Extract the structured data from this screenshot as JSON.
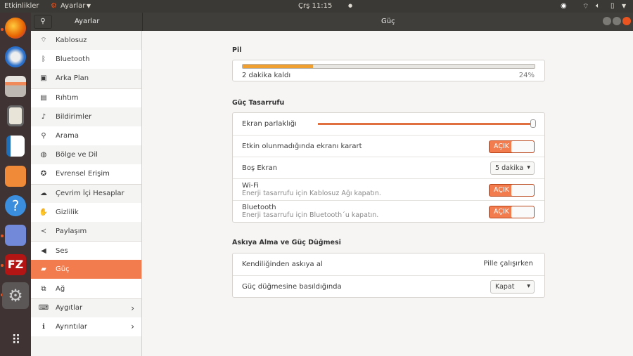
{
  "topbar": {
    "activities": "Etkinlikler",
    "app": "Ayarlar",
    "clock": "Çrş 11:15"
  },
  "dock": {
    "apps": [
      "firefox",
      "thunderbird",
      "files",
      "rhythmbox",
      "writer",
      "software-center",
      "help",
      "discord",
      "filezilla",
      "settings",
      "show-apps"
    ]
  },
  "header": {
    "sidebar_title": "Ayarlar",
    "page_title": "Güç"
  },
  "sidebar": {
    "items": [
      {
        "label": "Kablosuz",
        "icon": "wifi-icon"
      },
      {
        "label": "Bluetooth",
        "icon": "bluetooth-icon"
      },
      {
        "label": "Arka Plan",
        "icon": "background-icon"
      },
      {
        "label": "Rıhtım",
        "icon": "dock-icon"
      },
      {
        "label": "Bildirimler",
        "icon": "bell-icon"
      },
      {
        "label": "Arama",
        "icon": "search-icon"
      },
      {
        "label": "Bölge ve Dil",
        "icon": "globe-icon"
      },
      {
        "label": "Evrensel Erişim",
        "icon": "accessibility-icon"
      },
      {
        "label": "Çevrim İçi Hesaplar",
        "icon": "accounts-icon"
      },
      {
        "label": "Gizlilik",
        "icon": "hand-icon"
      },
      {
        "label": "Paylaşım",
        "icon": "share-icon"
      },
      {
        "label": "Ses",
        "icon": "speaker-icon"
      },
      {
        "label": "Güç",
        "icon": "power-icon"
      },
      {
        "label": "Ağ",
        "icon": "network-icon"
      },
      {
        "label": "Aygıtlar",
        "icon": "devices-icon"
      },
      {
        "label": "Ayrıntılar",
        "icon": "info-icon"
      }
    ]
  },
  "battery": {
    "title": "Pil",
    "status": "2 dakika kaldı",
    "percent_label": "24%",
    "percent": 24
  },
  "power_saving": {
    "title": "Güç Tasarrufu",
    "brightness_label": "Ekran parlaklığı",
    "brightness": 100,
    "dim_label": "Etkin olunmadığında ekranı karart",
    "toggle_on": "AÇIK",
    "blank_label": "Boş Ekran",
    "blank_value": "5 dakika",
    "wifi_label": "Wi-Fi",
    "wifi_sub": "Enerji tasarrufu için Kablosuz Ağı kapatın.",
    "bt_label": "Bluetooth",
    "bt_sub": "Enerji tasarrufu için Bluetooth΄u kapatın."
  },
  "suspend": {
    "title": "Askıya Alma ve Güç Düğmesi",
    "auto_label": "Kendiliğinden askıya al",
    "auto_value": "Pille çalışırken",
    "button_label": "Güç düğmesine basıldığında",
    "button_value": "Kapat"
  },
  "colors": {
    "accent": "#f27c4d"
  }
}
